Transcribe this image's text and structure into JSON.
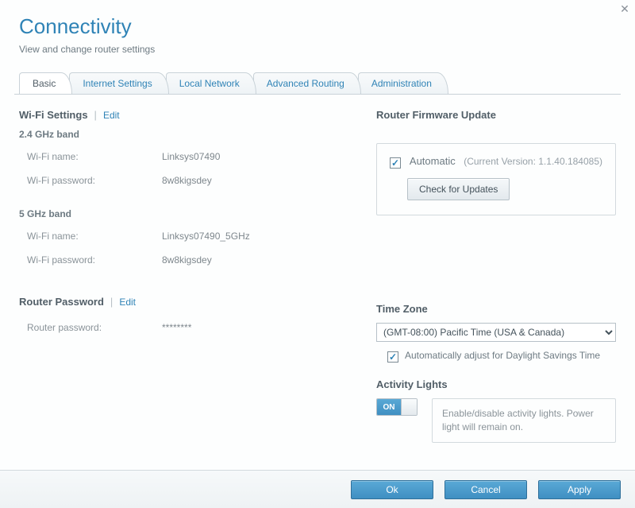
{
  "header": {
    "title": "Connectivity",
    "subtitle": "View and change router settings"
  },
  "tabs": {
    "items": [
      {
        "label": "Basic",
        "active": true
      },
      {
        "label": "Internet Settings",
        "active": false
      },
      {
        "label": "Local Network",
        "active": false
      },
      {
        "label": "Advanced Routing",
        "active": false
      },
      {
        "label": "Administration",
        "active": false
      }
    ]
  },
  "wifi": {
    "section_title": "Wi-Fi Settings",
    "edit_label": "Edit",
    "band24_label": "2.4 GHz band",
    "band5_label": "5 GHz band",
    "name_label": "Wi-Fi name:",
    "password_label": "Wi-Fi password:",
    "band24": {
      "name": "Linksys07490",
      "password": "8w8kigsdey"
    },
    "band5": {
      "name": "Linksys07490_5GHz",
      "password": "8w8kigsdey"
    }
  },
  "router_password": {
    "section_title": "Router Password",
    "edit_label": "Edit",
    "label": "Router password:",
    "value": "********"
  },
  "firmware": {
    "section_title": "Router Firmware Update",
    "automatic_label": "Automatic",
    "automatic_checked": true,
    "current_version_text": "(Current Version: 1.1.40.184085)",
    "check_button": "Check for Updates"
  },
  "timezone": {
    "section_title": "Time Zone",
    "selected": "(GMT-08:00) Pacific Time (USA & Canada)",
    "dst_checked": true,
    "dst_label": "Automatically adjust for Daylight Savings Time"
  },
  "activity": {
    "section_title": "Activity Lights",
    "toggle_state": "ON",
    "description": "Enable/disable activity lights. Power light will remain on."
  },
  "footer": {
    "ok": "Ok",
    "cancel": "Cancel",
    "apply": "Apply"
  }
}
